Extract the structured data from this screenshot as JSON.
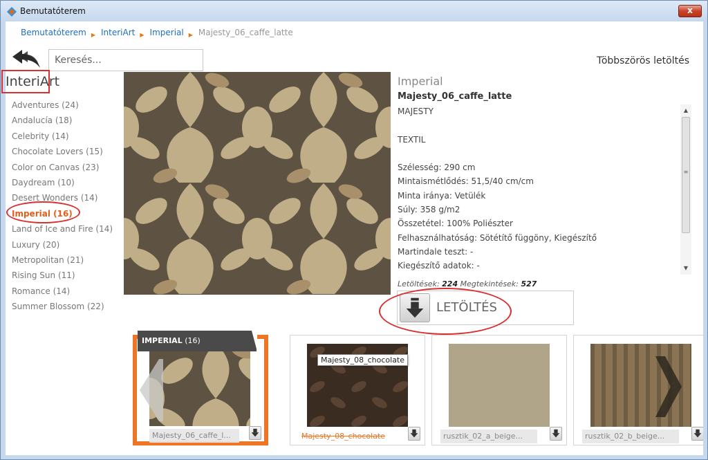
{
  "window": {
    "title": "Bemutatóterem",
    "close_label": "x"
  },
  "breadcrumb": [
    "Bemutatóterem",
    "InteriArt",
    "Imperial",
    "Majesty_06_caffe_latte"
  ],
  "search": {
    "placeholder": "Keresés..."
  },
  "toolbar": {
    "multi_download": "Többszörös letöltés"
  },
  "brand": {
    "title": "InteriArt"
  },
  "collections": [
    "Adventures (24)",
    "Andalucía (18)",
    "Celebrity (14)",
    "Chocolate Lovers (15)",
    "Color on Canvas (23)",
    "Daydream (10)",
    "Desert Wonders (14)",
    "Imperial (16)",
    "Land of Ice and Fire (14)",
    "Luxury (20)",
    "Metropolitan (21)",
    "Rising Sun (11)",
    "Romance (14)",
    "Summer Blossom (22)"
  ],
  "active_collection_index": 7,
  "detail": {
    "collection": "Imperial",
    "name": "Majesty_06_caffe_latte",
    "specs": [
      "MAJESTY",
      "",
      "TEXTIL",
      "",
      "Szélesség: 290 cm",
      "Mintaismétlődés: 51,5/40 cm/cm",
      "Minta iránya: Vetülék",
      "Súly: 358 g/m2",
      "Összetétel: 100% Poliészter",
      "Felhasználhatóság: Sötétítő függöny, Kiegészítő",
      "Martindale teszt: -",
      "Kiegészítő adatok: -"
    ],
    "stats": {
      "downloads_label": "Letöltések:",
      "downloads": "224",
      "views_label": "Megtekintések:",
      "views": "527"
    },
    "download_label": "LETÖLTÉS"
  },
  "strip": {
    "badge_name": "IMPERIAL",
    "badge_count": "(16)",
    "items": [
      {
        "label": "Majesty_06_caffe_l...",
        "selected": true
      },
      {
        "label": "Majesty_08_chocolate",
        "selected": false
      },
      {
        "label": "rusztik_02_a_beige...",
        "selected": false
      },
      {
        "label": "rusztik_02_b_beige...",
        "selected": false
      }
    ],
    "tooltip": "Majesty_08_chocolate"
  },
  "colors": {
    "accent_orange": "#ec7625",
    "link_blue": "#1f6fbd",
    "annotation_red": "#d83030"
  },
  "icons": [
    "app-icon",
    "back-arrows-icon",
    "download-arrow-icon",
    "prev-chevron-icon",
    "next-chevron-icon"
  ]
}
